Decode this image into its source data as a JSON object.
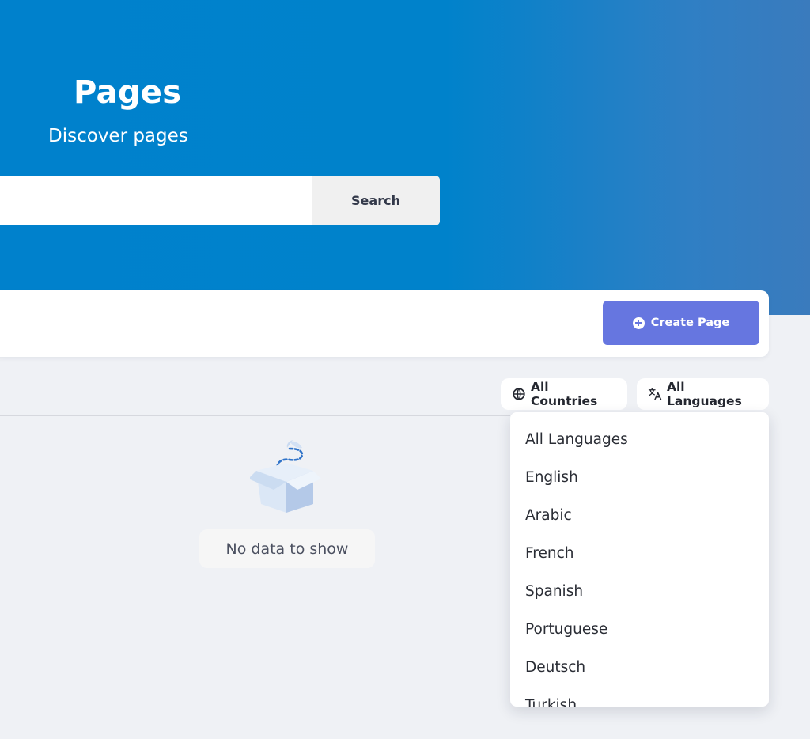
{
  "hero": {
    "title": "Pages",
    "subtitle": "Discover pages",
    "search_placeholder": "",
    "search_button_label": "Search"
  },
  "toolbar": {
    "create_button_label": "Create Page",
    "create_button_icon": "plus-circle-icon"
  },
  "filters": {
    "countries_label": "All Countries",
    "countries_icon": "globe-icon",
    "languages_label": "All Languages",
    "languages_icon": "translate-icon"
  },
  "empty_state": {
    "icon": "open-box-icon",
    "message": "No data to show"
  },
  "language_dropdown": {
    "items": [
      "All Languages",
      "English",
      "Arabic",
      "French",
      "Spanish",
      "Portuguese",
      "Deutsch",
      "Turkish"
    ]
  },
  "colors": {
    "hero_blue": "#0081cc",
    "primary_button": "#6676e0",
    "page_background": "#eff1f5"
  }
}
